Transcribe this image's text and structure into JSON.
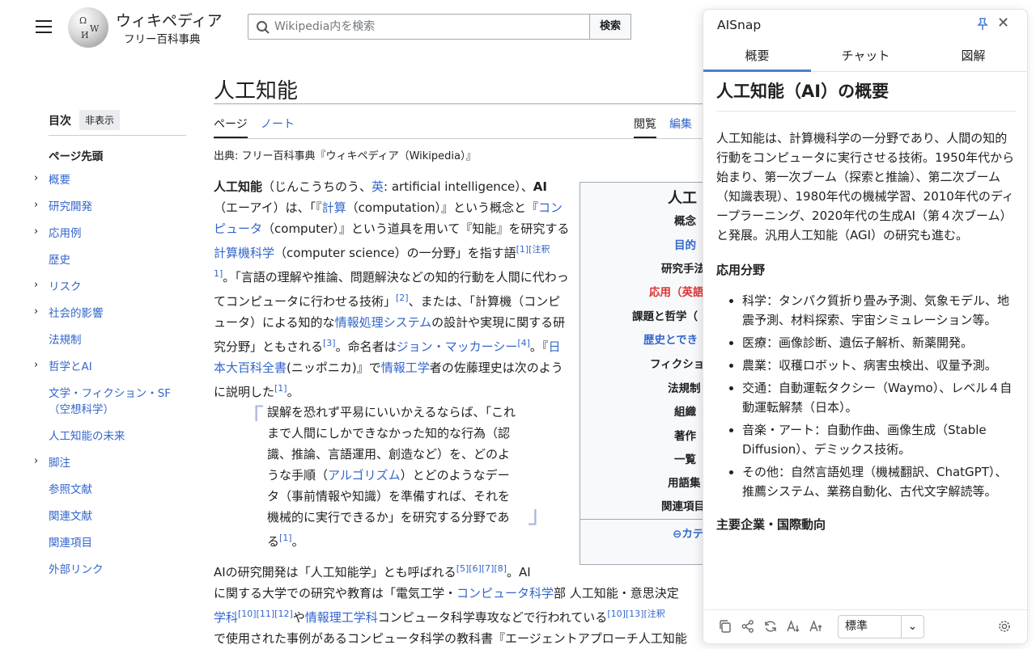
{
  "header": {
    "logo_line1": "ウィキペディア",
    "logo_line2": "フリー百科事典",
    "search_placeholder": "Wikipedia内を検索",
    "search_button": "検索"
  },
  "toc": {
    "title": "目次",
    "hide": "非表示",
    "top": "ページ先頭",
    "items": [
      {
        "label": "概要",
        "expandable": true
      },
      {
        "label": "研究開発",
        "expandable": true
      },
      {
        "label": "応用例",
        "expandable": true
      },
      {
        "label": "歴史",
        "expandable": false
      },
      {
        "label": "リスク",
        "expandable": true
      },
      {
        "label": "社会的影響",
        "expandable": true
      },
      {
        "label": "法規制",
        "expandable": false
      },
      {
        "label": "哲学とAI",
        "expandable": true
      },
      {
        "label": "文学・フィクション・SF（空想科学）",
        "expandable": false
      },
      {
        "label": "人工知能の未来",
        "expandable": false
      },
      {
        "label": "脚注",
        "expandable": true
      },
      {
        "label": "参照文献",
        "expandable": false
      },
      {
        "label": "関連文献",
        "expandable": false
      },
      {
        "label": "関連項目",
        "expandable": false
      },
      {
        "label": "外部リンク",
        "expandable": false
      }
    ]
  },
  "article": {
    "title": "人工知能",
    "tab_page": "ページ",
    "tab_note": "ノート",
    "tab_read": "閲覧",
    "tab_edit": "編集",
    "from": "出典: フリー百科事典『ウィキペディア（Wikipedia）』",
    "infobox_title": "人工",
    "infobox_rows": [
      "概念",
      "目的",
      "研究手法",
      "応用（英語",
      "課題と哲学（",
      "歴史とでき",
      "フィクショ",
      "法規制",
      "組織",
      "著作",
      "一覧",
      "用語集",
      "関連項目"
    ],
    "infobox_footer": "カテ"
  },
  "panel": {
    "title": "AISnap",
    "tabs": [
      "概要",
      "チャット",
      "図解"
    ],
    "heading": "人工知能（AI）の概要",
    "summary": "人工知能は、計算機科学の一分野であり、人間の知的行動をコンピュータに実行させる技術。1950年代から始まり、第一次ブーム（探索と推論）、第二次ブーム（知識表現）、1980年代の機械学習、2010年代のディープラーニング、2020年代の生成AI（第４次ブーム）と発展。汎用人工知能（AGI）の研究も進む。",
    "section1": "応用分野",
    "bullets": [
      "科学：タンパク質折り畳み予測、気象モデル、地震予測、材料探索、宇宙シミュレーション等。",
      "医療：画像診断、遺伝子解析、新薬開発。",
      "農業：収穫ロボット、病害虫検出、収量予測。",
      "交通：自動運転タクシー（Waymo）、レベル４自動運転解禁（日本）。",
      "音楽・アート：自動作曲、画像生成（Stable Diffusion）、デミックス技術。",
      "その他：自然言語処理（機械翻訳、ChatGPT）、推薦システム、業務自動化、古代文字解読等。"
    ],
    "section2": "主要企業・国際動向",
    "select_value": "標準",
    "accent": "#4a7fd0"
  }
}
